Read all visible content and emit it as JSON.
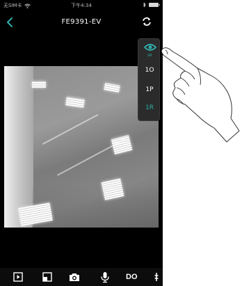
{
  "status_bar": {
    "carrier": "无SIM卡",
    "time": "下午4:34"
  },
  "header": {
    "title": "FE9391-EV"
  },
  "resolution_menu": {
    "selected_sublabel": "1R",
    "options": [
      "1O",
      "1P",
      "1R"
    ],
    "active_color": "#2fb0ad"
  },
  "toolbar": {
    "do_label": "DO"
  },
  "icons": [
    "wifi-icon",
    "bluetooth-icon",
    "battery-icon",
    "back-icon",
    "refresh-icon",
    "eye-icon",
    "play-icon",
    "layout-icon",
    "camera-icon",
    "microphone-icon",
    "more-icon"
  ]
}
